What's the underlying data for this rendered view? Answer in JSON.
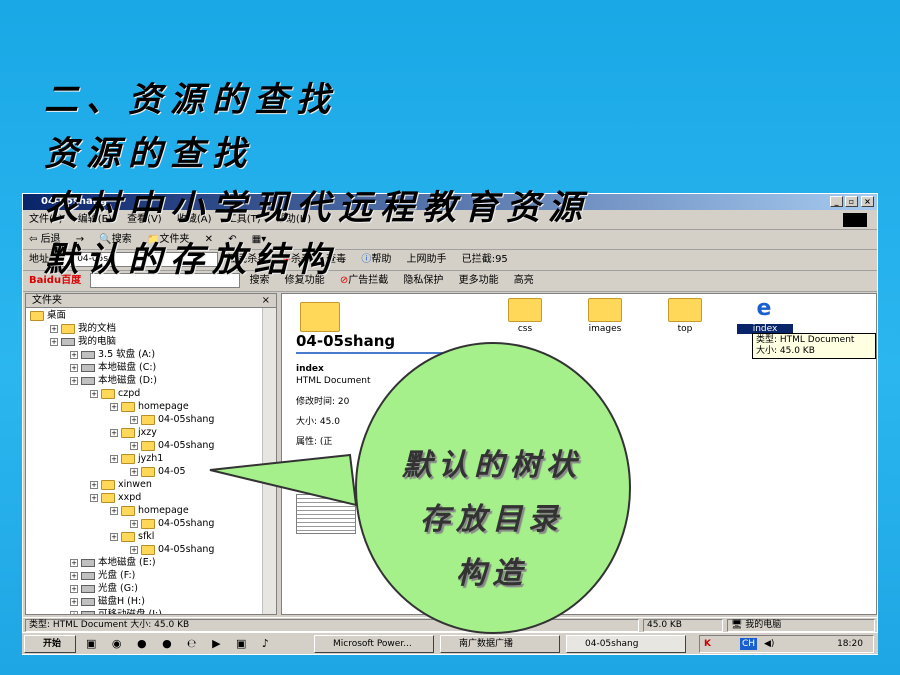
{
  "slide": {
    "line1": "二、资源的查找",
    "line2": "资源的查找",
    "line3": "农村中小学现代远程教育资源",
    "line4": "默认的存放结构"
  },
  "window": {
    "title": "04-05shang",
    "menu": [
      "文件(F)",
      "编辑(E)",
      "查看(V)",
      "收藏(A)",
      "工具(T)",
      "帮助(H)"
    ],
    "toolbar": [
      "后退",
      "→",
      "搜索",
      "文件夹"
    ],
    "address_label": "地址",
    "address_value": "04-05s",
    "toolbar2": [
      "江民杀毒",
      "杀毒",
      "查毒",
      "帮助",
      "上网助手",
      "已拦截:95"
    ],
    "toolbar3_brand": "Baidu百度",
    "toolbar3": [
      "搜索",
      "修复功能",
      "广告拦截",
      "隐私保护",
      "更多功能",
      "高亮"
    ]
  },
  "tree": {
    "header": "文件夹",
    "items": [
      {
        "label": "桌面",
        "level": 0,
        "type": "desktop"
      },
      {
        "label": "我的文档",
        "level": 1,
        "type": "folder"
      },
      {
        "label": "我的电脑",
        "level": 1,
        "type": "pc"
      },
      {
        "label": "3.5 软盘 (A:)",
        "level": 2,
        "type": "drive"
      },
      {
        "label": "本地磁盘 (C:)",
        "level": 2,
        "type": "drive"
      },
      {
        "label": "本地磁盘 (D:)",
        "level": 2,
        "type": "drive"
      },
      {
        "label": "czpd",
        "level": 3,
        "type": "folder"
      },
      {
        "label": "homepage",
        "level": 4,
        "type": "folder"
      },
      {
        "label": "04-05shang",
        "level": 5,
        "type": "folder"
      },
      {
        "label": "jxzy",
        "level": 4,
        "type": "folder"
      },
      {
        "label": "04-05shang",
        "level": 5,
        "type": "folder"
      },
      {
        "label": "jyzh1",
        "level": 4,
        "type": "folder"
      },
      {
        "label": "04-05",
        "level": 5,
        "type": "folder"
      },
      {
        "label": "xinwen",
        "level": 3,
        "type": "folder"
      },
      {
        "label": "xxpd",
        "level": 3,
        "type": "folder"
      },
      {
        "label": "homepage",
        "level": 4,
        "type": "folder"
      },
      {
        "label": "04-05shang",
        "level": 5,
        "type": "folder"
      },
      {
        "label": "sfkl",
        "level": 4,
        "type": "folder"
      },
      {
        "label": "04-05shang",
        "level": 5,
        "type": "folder"
      },
      {
        "label": "本地磁盘 (E:)",
        "level": 2,
        "type": "drive"
      },
      {
        "label": "光盘 (F:)",
        "level": 2,
        "type": "drive"
      },
      {
        "label": "光盘 (G:)",
        "level": 2,
        "type": "drive"
      },
      {
        "label": "磁盘H (H:)",
        "level": 2,
        "type": "drive"
      },
      {
        "label": "可移动磁盘 (I:)",
        "level": 2,
        "type": "drive"
      }
    ]
  },
  "content": {
    "folder_title": "04-05shang",
    "selected_name": "index",
    "selected_type": "HTML Document",
    "modified_label": "修改时间: 20",
    "size_label": "大小: 45.0",
    "attr_label": "属性: (正",
    "icons": [
      "css",
      "images",
      "top",
      "index"
    ],
    "tooltip_type": "类型: HTML Document",
    "tooltip_size": "大小: 45.0 KB"
  },
  "callout": {
    "line1": "默认的树状",
    "line2": "存放目录",
    "line3": "构造"
  },
  "status": {
    "left": "类型: HTML Document 大小: 45.0 KB",
    "size": "45.0 KB",
    "zone": "我的电脑"
  },
  "taskbar": {
    "start": "开始",
    "tasks": [
      "Microsoft Power...",
      "南广数据广播",
      "04-05shang"
    ],
    "clock": "18:20",
    "tray_lang": "CH"
  },
  "colors": {
    "slide_bg": "#1aa8e6",
    "callout_fill": "#a6f08c",
    "titlebar": "#0a246a"
  }
}
